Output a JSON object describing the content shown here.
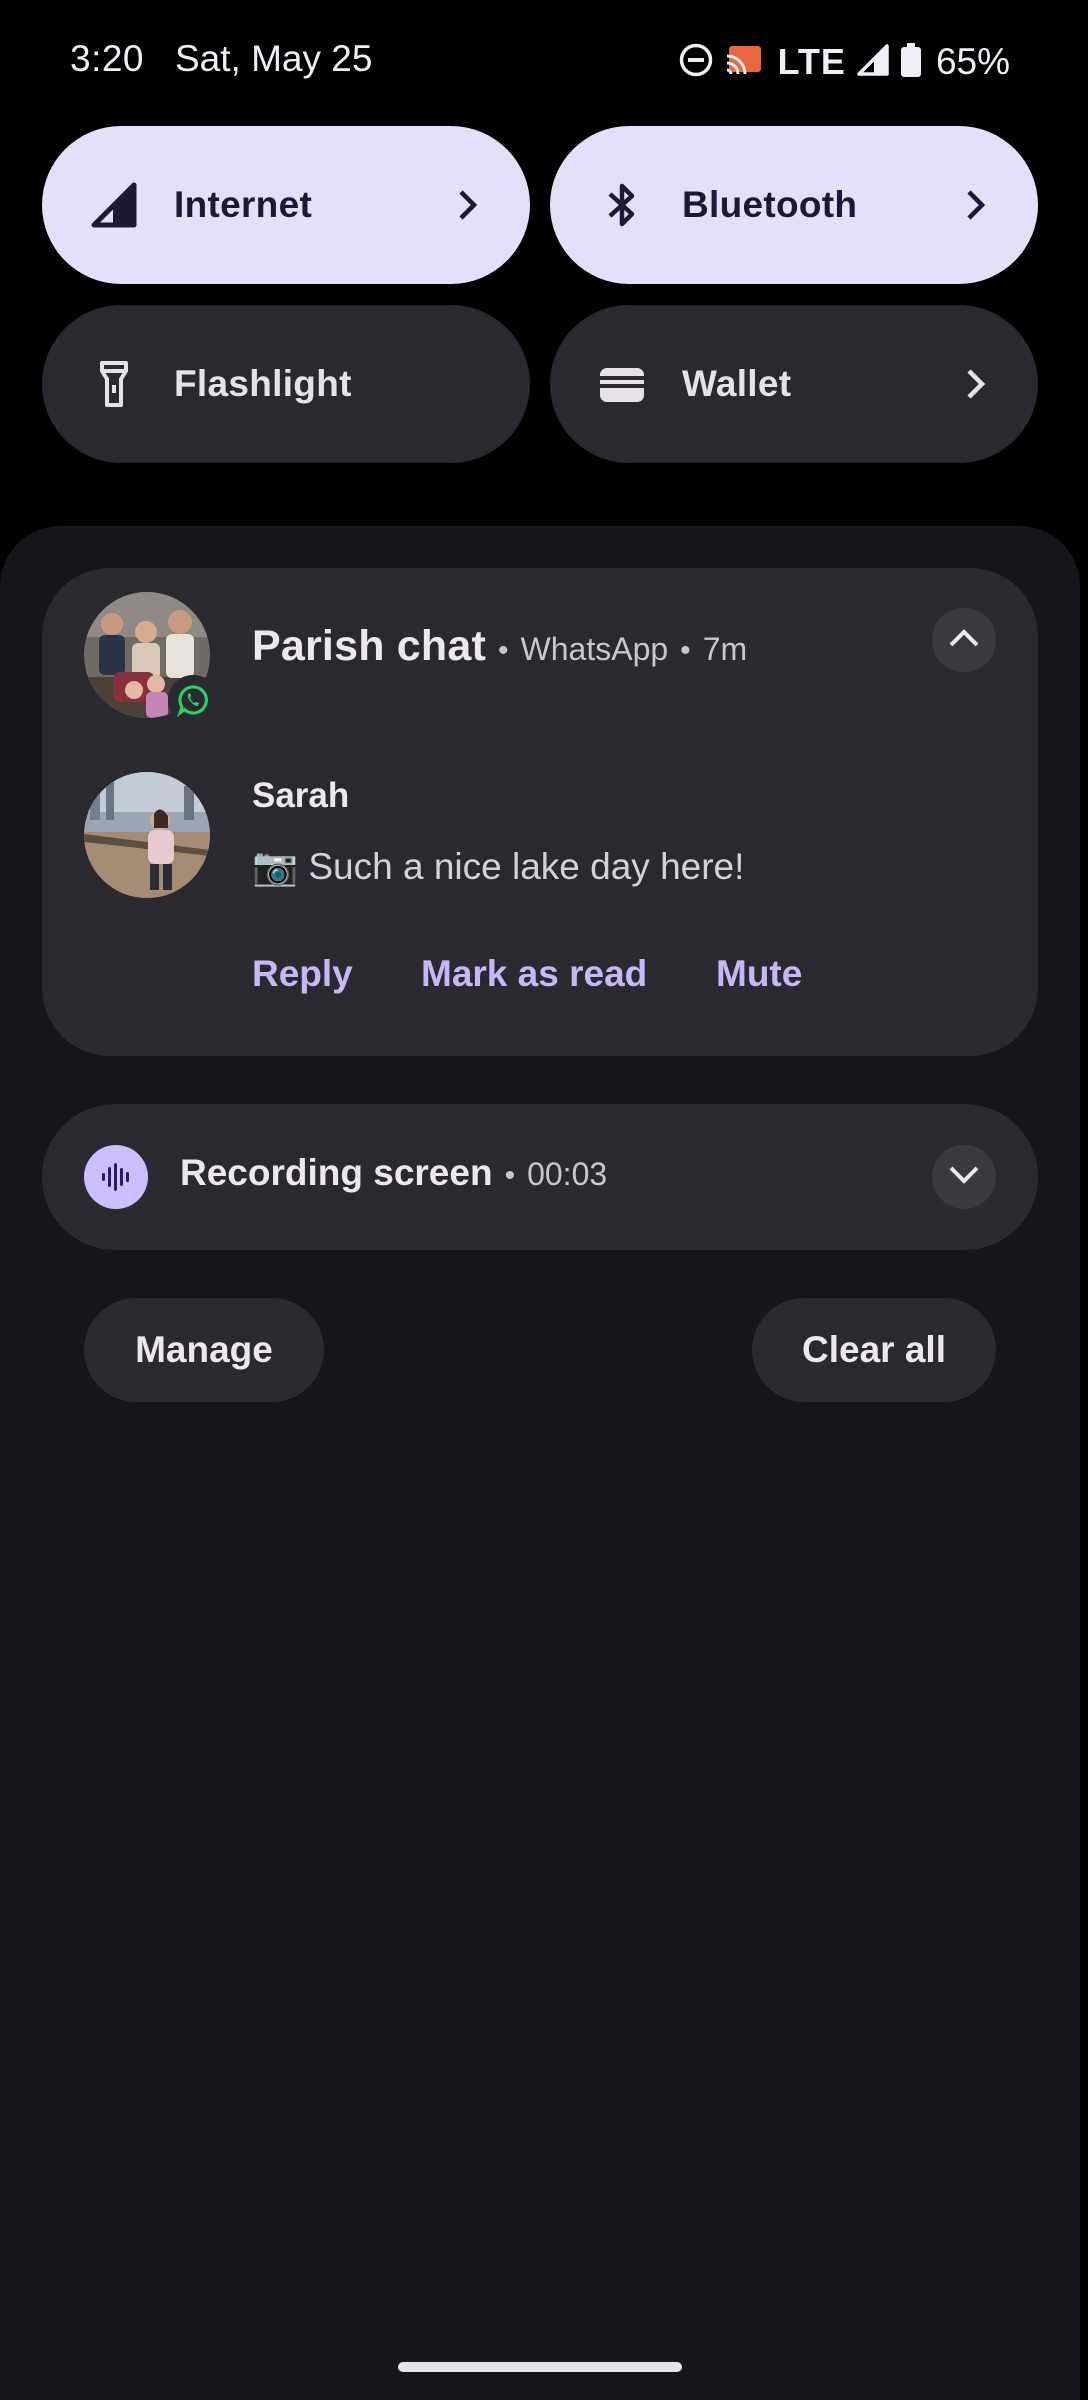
{
  "status_bar": {
    "time": "3:20",
    "date": "Sat, May 25",
    "network": "LTE",
    "battery": "65%",
    "icons": [
      "do-not-disturb-icon",
      "cast-icon",
      "signal-icon",
      "battery-icon"
    ]
  },
  "quick_settings": {
    "tiles": [
      {
        "label": "Internet",
        "icon": "signal-icon",
        "state": "active",
        "has_chevron": true
      },
      {
        "label": "Bluetooth",
        "icon": "bluetooth-icon",
        "state": "active",
        "has_chevron": true
      },
      {
        "label": "Flashlight",
        "icon": "flashlight-icon",
        "state": "inactive",
        "has_chevron": false
      },
      {
        "label": "Wallet",
        "icon": "wallet-icon",
        "state": "inactive",
        "has_chevron": true
      }
    ]
  },
  "notifications": {
    "chat": {
      "title": "Parish chat",
      "app": "WhatsApp",
      "time": "7m",
      "sender": "Sarah",
      "message": "📷 Such a nice lake day here!",
      "actions": {
        "reply": "Reply",
        "mark_read": "Mark as read",
        "mute": "Mute"
      }
    },
    "recording": {
      "title": "Recording screen",
      "duration": "00:03"
    }
  },
  "footer": {
    "manage": "Manage",
    "clear_all": "Clear all"
  },
  "colors": {
    "tile_active": "#e5dff9",
    "tile_inactive": "#2b2930",
    "accent": "#c7b8f5",
    "whatsapp": "#25d366",
    "recording_icon_bg": "#cdbfff"
  }
}
